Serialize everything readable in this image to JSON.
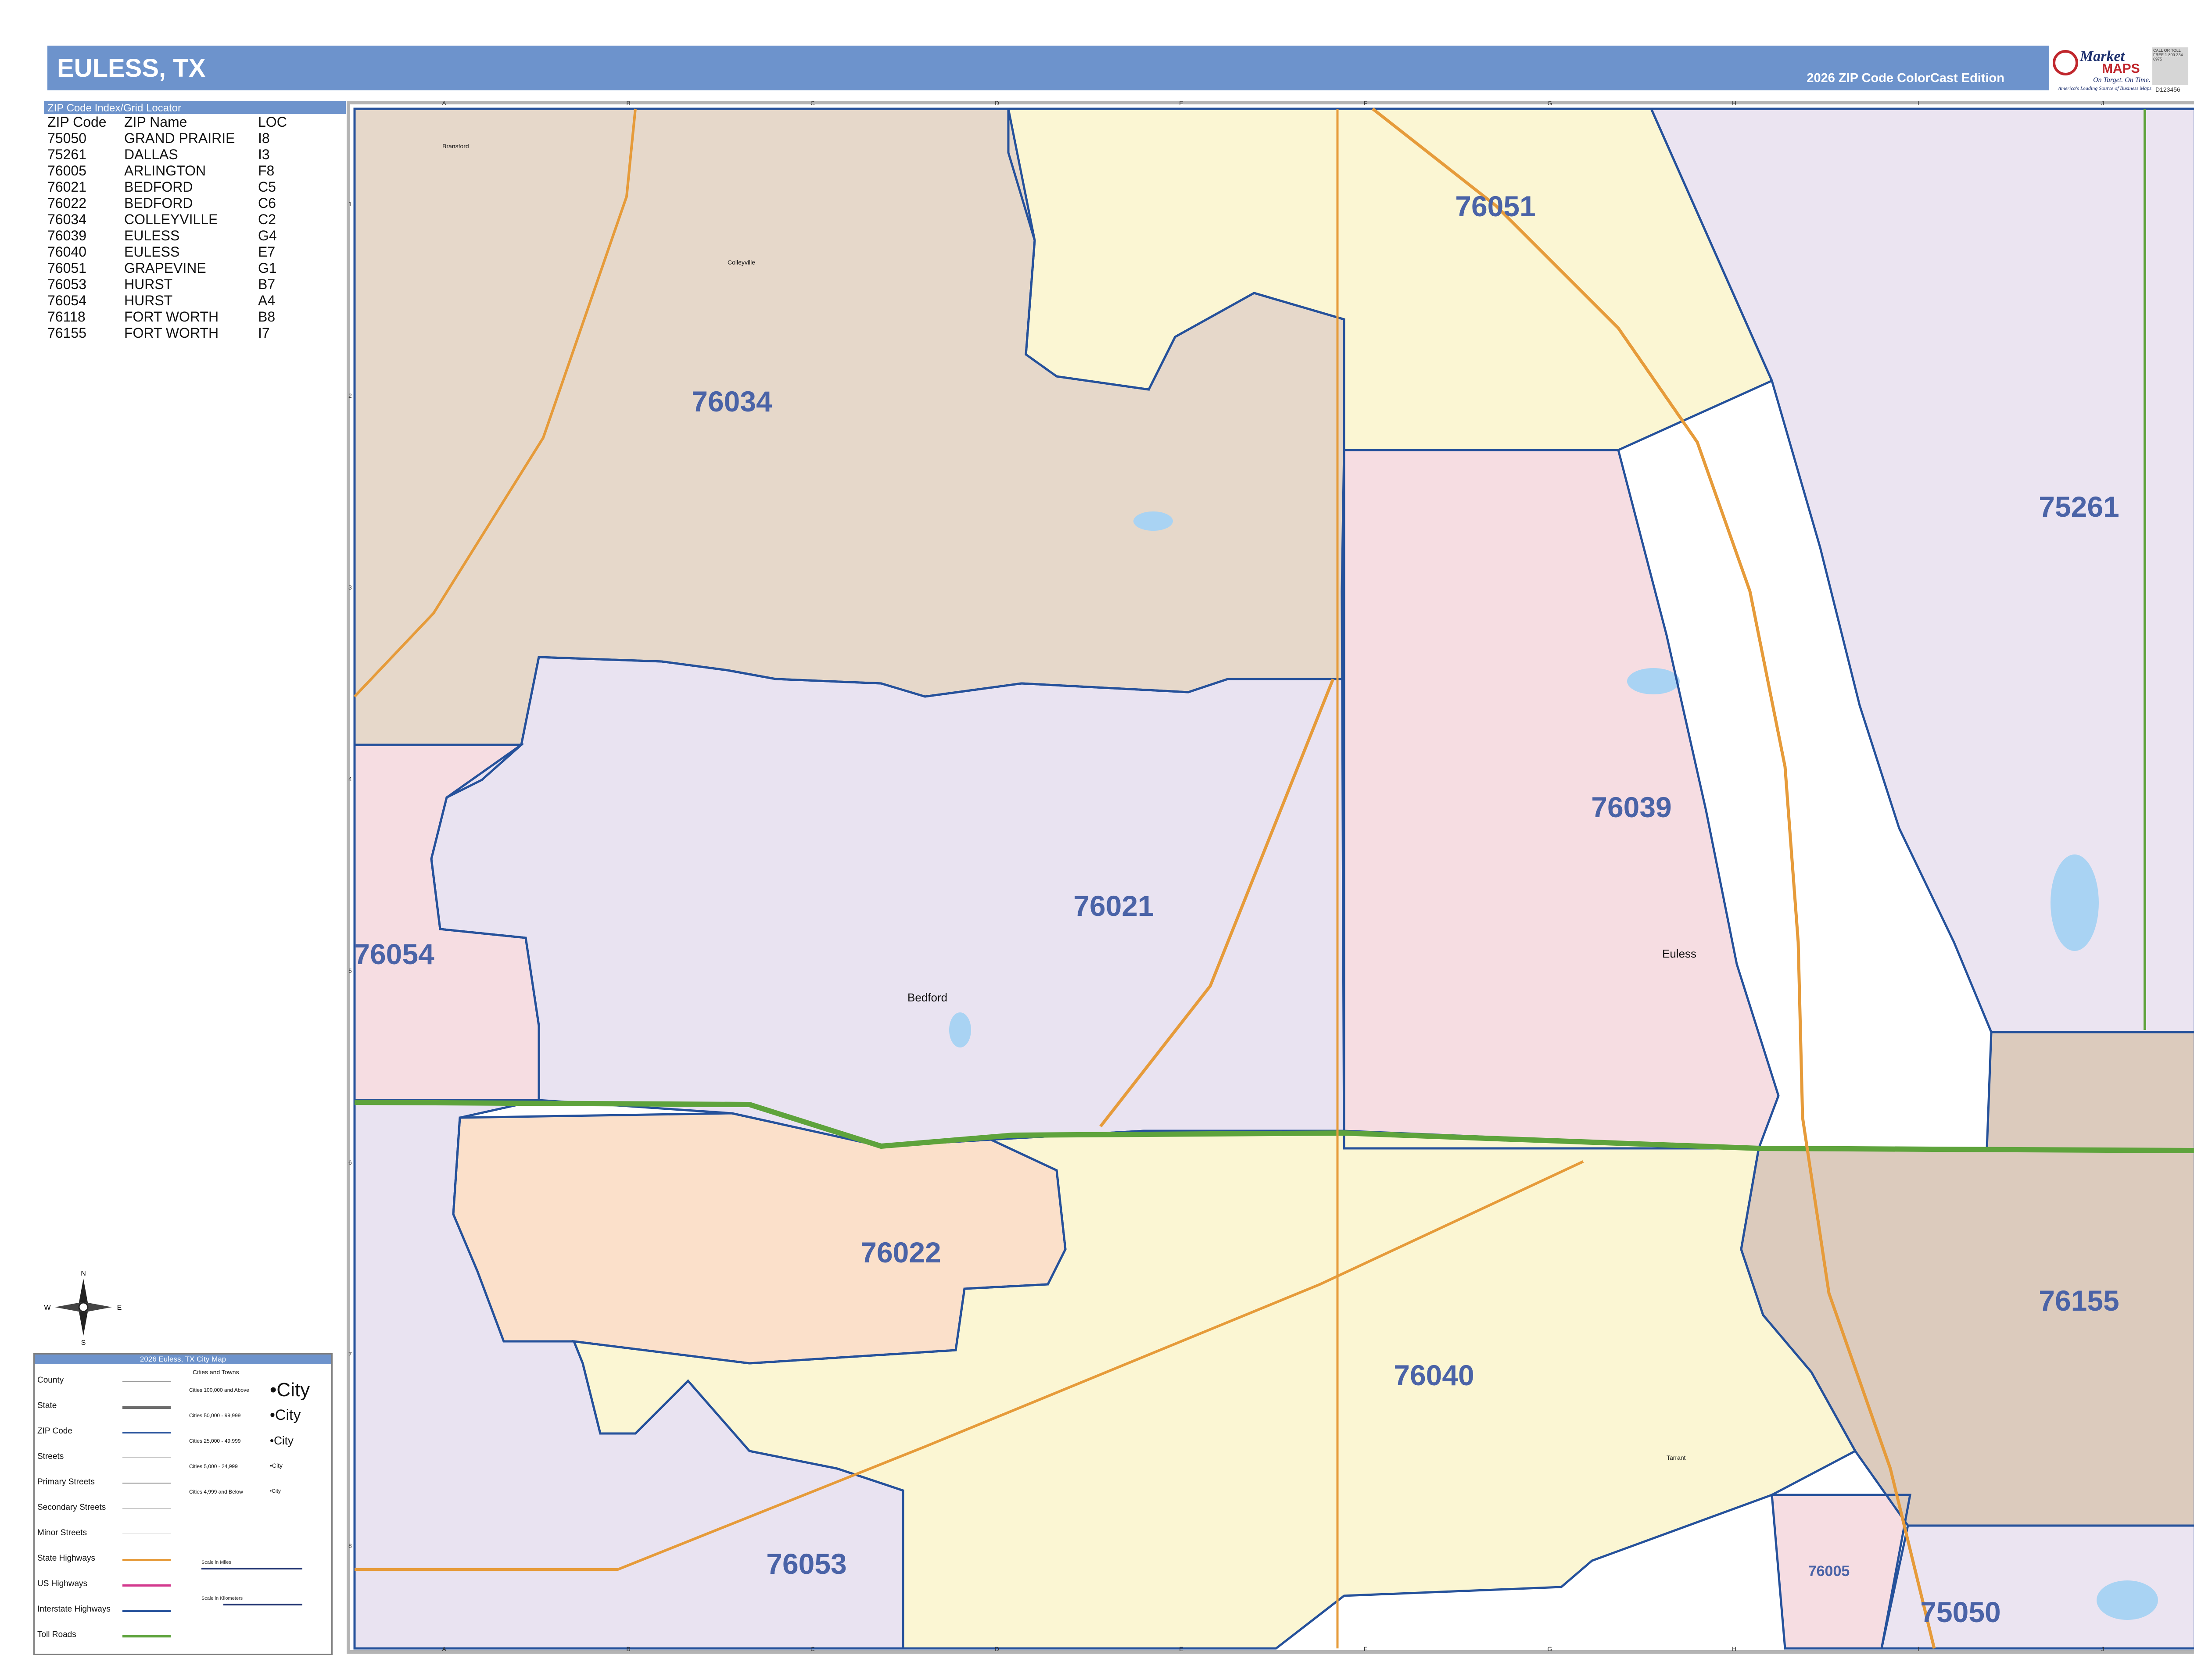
{
  "header": {
    "title": "EULESS, TX",
    "edition": "2026 ZIP Code ColorCast Edition"
  },
  "logo": {
    "brand_line1": "Market",
    "brand_line2": "MAPS",
    "tagline": "On Target. On Time.",
    "tagline2": "America's Leading Source of Business Maps",
    "badge_text": "CALL OR TOLL FREE 1-800-334-6975",
    "code": "D123456",
    "brand_color": "#c0272d"
  },
  "zip_index": {
    "title": "ZIP Code Index/Grid Locator",
    "columns": [
      "ZIP Code",
      "ZIP Name",
      "LOC"
    ],
    "rows": [
      [
        "75050",
        "GRAND PRAIRIE",
        "I8"
      ],
      [
        "75261",
        "DALLAS",
        "I3"
      ],
      [
        "76005",
        "ARLINGTON",
        "F8"
      ],
      [
        "76021",
        "BEDFORD",
        "C5"
      ],
      [
        "76022",
        "BEDFORD",
        "C6"
      ],
      [
        "76034",
        "COLLEYVILLE",
        "C2"
      ],
      [
        "76039",
        "EULESS",
        "G4"
      ],
      [
        "76040",
        "EULESS",
        "E7"
      ],
      [
        "76051",
        "GRAPEVINE",
        "G1"
      ],
      [
        "76053",
        "HURST",
        "B7"
      ],
      [
        "76054",
        "HURST",
        "A4"
      ],
      [
        "76118",
        "FORT WORTH",
        "B8"
      ],
      [
        "76155",
        "FORT WORTH",
        "I7"
      ]
    ]
  },
  "map": {
    "zip_labels": [
      "76034",
      "76051",
      "75261",
      "76039",
      "76021",
      "76054",
      "76022",
      "76040",
      "76155",
      "76053",
      "76005",
      "75050"
    ],
    "city_labels": [
      "Bedford",
      "Euless",
      "Colleyville",
      "Tarrant",
      "Bransford"
    ],
    "grid_columns": [
      "A",
      "B",
      "C",
      "D",
      "E",
      "F",
      "G",
      "H",
      "I",
      "J"
    ],
    "grid_rows": [
      "1",
      "2",
      "3",
      "4",
      "5",
      "6",
      "7",
      "8"
    ],
    "zip_colors": {
      "76034": "#e6d8ca",
      "76051": "#fbf6d3",
      "75261": "#ebe4f1",
      "76039": "#f6dde2",
      "76021": "#e9e3f1",
      "76054": "#f6dde2",
      "76022": "#fbe0ca",
      "76040": "#fbf6d3",
      "76155": "#dccbbd",
      "76053": "#e9e3f1",
      "76005": "#f6dde2",
      "75050": "#ebe4f1"
    },
    "label_color": "#4a63a7",
    "boundary_color": "#25519b",
    "highway_color": "#5ea33c",
    "road_color": "#e69b3a"
  },
  "compass": {
    "n": "N",
    "s": "S",
    "e": "E",
    "w": "W"
  },
  "legend": {
    "title": "2026 Euless, TX City Map",
    "items": [
      "County",
      "State",
      "ZIP Code",
      "Streets",
      "Primary Streets",
      "Secondary Streets",
      "Minor Streets",
      "State Highways",
      "US Highways",
      "Interstate Highways",
      "Toll Roads"
    ],
    "cities_title": "Cities and Towns",
    "city_tiers": [
      {
        "range": "Cities 100,000 and Above",
        "sample": "City"
      },
      {
        "range": "Cities 50,000 - 99,999",
        "sample": "City"
      },
      {
        "range": "Cities 25,000 - 49,999",
        "sample": "City"
      },
      {
        "range": "Cities 5,000 - 24,999",
        "sample": "City"
      },
      {
        "range": "Cities 4,999 and Below",
        "sample": "City"
      }
    ],
    "scale_miles": "Scale in Miles",
    "scale_km": "Scale in Kilometers"
  }
}
